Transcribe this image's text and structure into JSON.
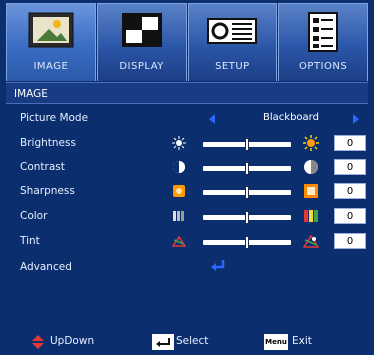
{
  "tabs": [
    {
      "label": "IMAGE",
      "active": true
    },
    {
      "label": "DISPLAY",
      "active": false
    },
    {
      "label": "SETUP",
      "active": false
    },
    {
      "label": "OPTIONS",
      "active": false
    }
  ],
  "section_title": "IMAGE",
  "rows": {
    "picture_mode": {
      "label": "Picture Mode",
      "value": "Blackboard"
    },
    "brightness": {
      "label": "Brightness",
      "value": "0",
      "level": 0.5
    },
    "contrast": {
      "label": "Contrast",
      "value": "0",
      "level": 0.5
    },
    "sharpness": {
      "label": "Sharpness",
      "value": "0",
      "level": 0.5
    },
    "color": {
      "label": "Color",
      "value": "0",
      "level": 0.5
    },
    "tint": {
      "label": "Tint",
      "value": "0",
      "level": 0.5
    },
    "advanced": {
      "label": "Advanced"
    }
  },
  "footer": {
    "updown": "UpDown",
    "select": "Select",
    "menu_key": "Menu",
    "exit": "Exit"
  },
  "colors": {
    "background": "#0b2f6e",
    "tab": "#3b6cc4",
    "arrow": "#2a66ff",
    "accent_orange": "#ff8a00"
  }
}
